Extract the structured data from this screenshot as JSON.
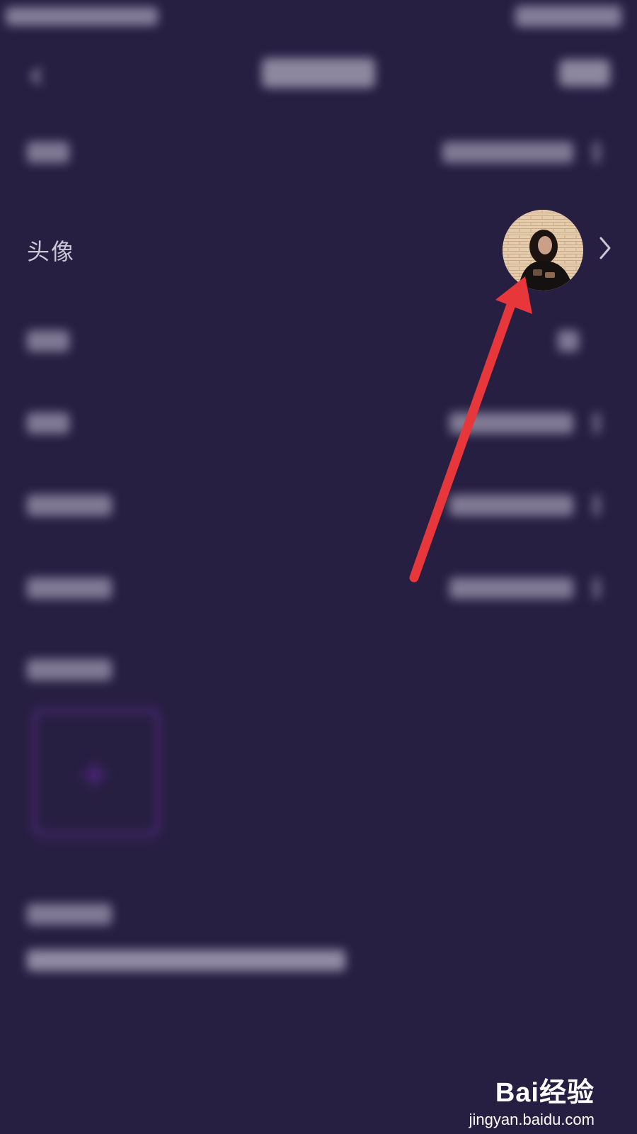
{
  "nav": {
    "back_icon": "chevron-left-icon",
    "back_glyph": "‹"
  },
  "rows": {
    "avatar": {
      "label": "头像",
      "chevron_icon": "chevron-right-icon"
    }
  },
  "upload": {
    "plus_icon": "plus-icon",
    "plus_glyph": "+"
  },
  "watermark": {
    "brand": "Bai经验",
    "url": "jingyan.baidu.com"
  },
  "annotation": {
    "arrow_color": "#e8373a"
  },
  "colors": {
    "background": "#271f42",
    "accent_purple": "#5b2b8a",
    "text": "#c9c6d6"
  }
}
